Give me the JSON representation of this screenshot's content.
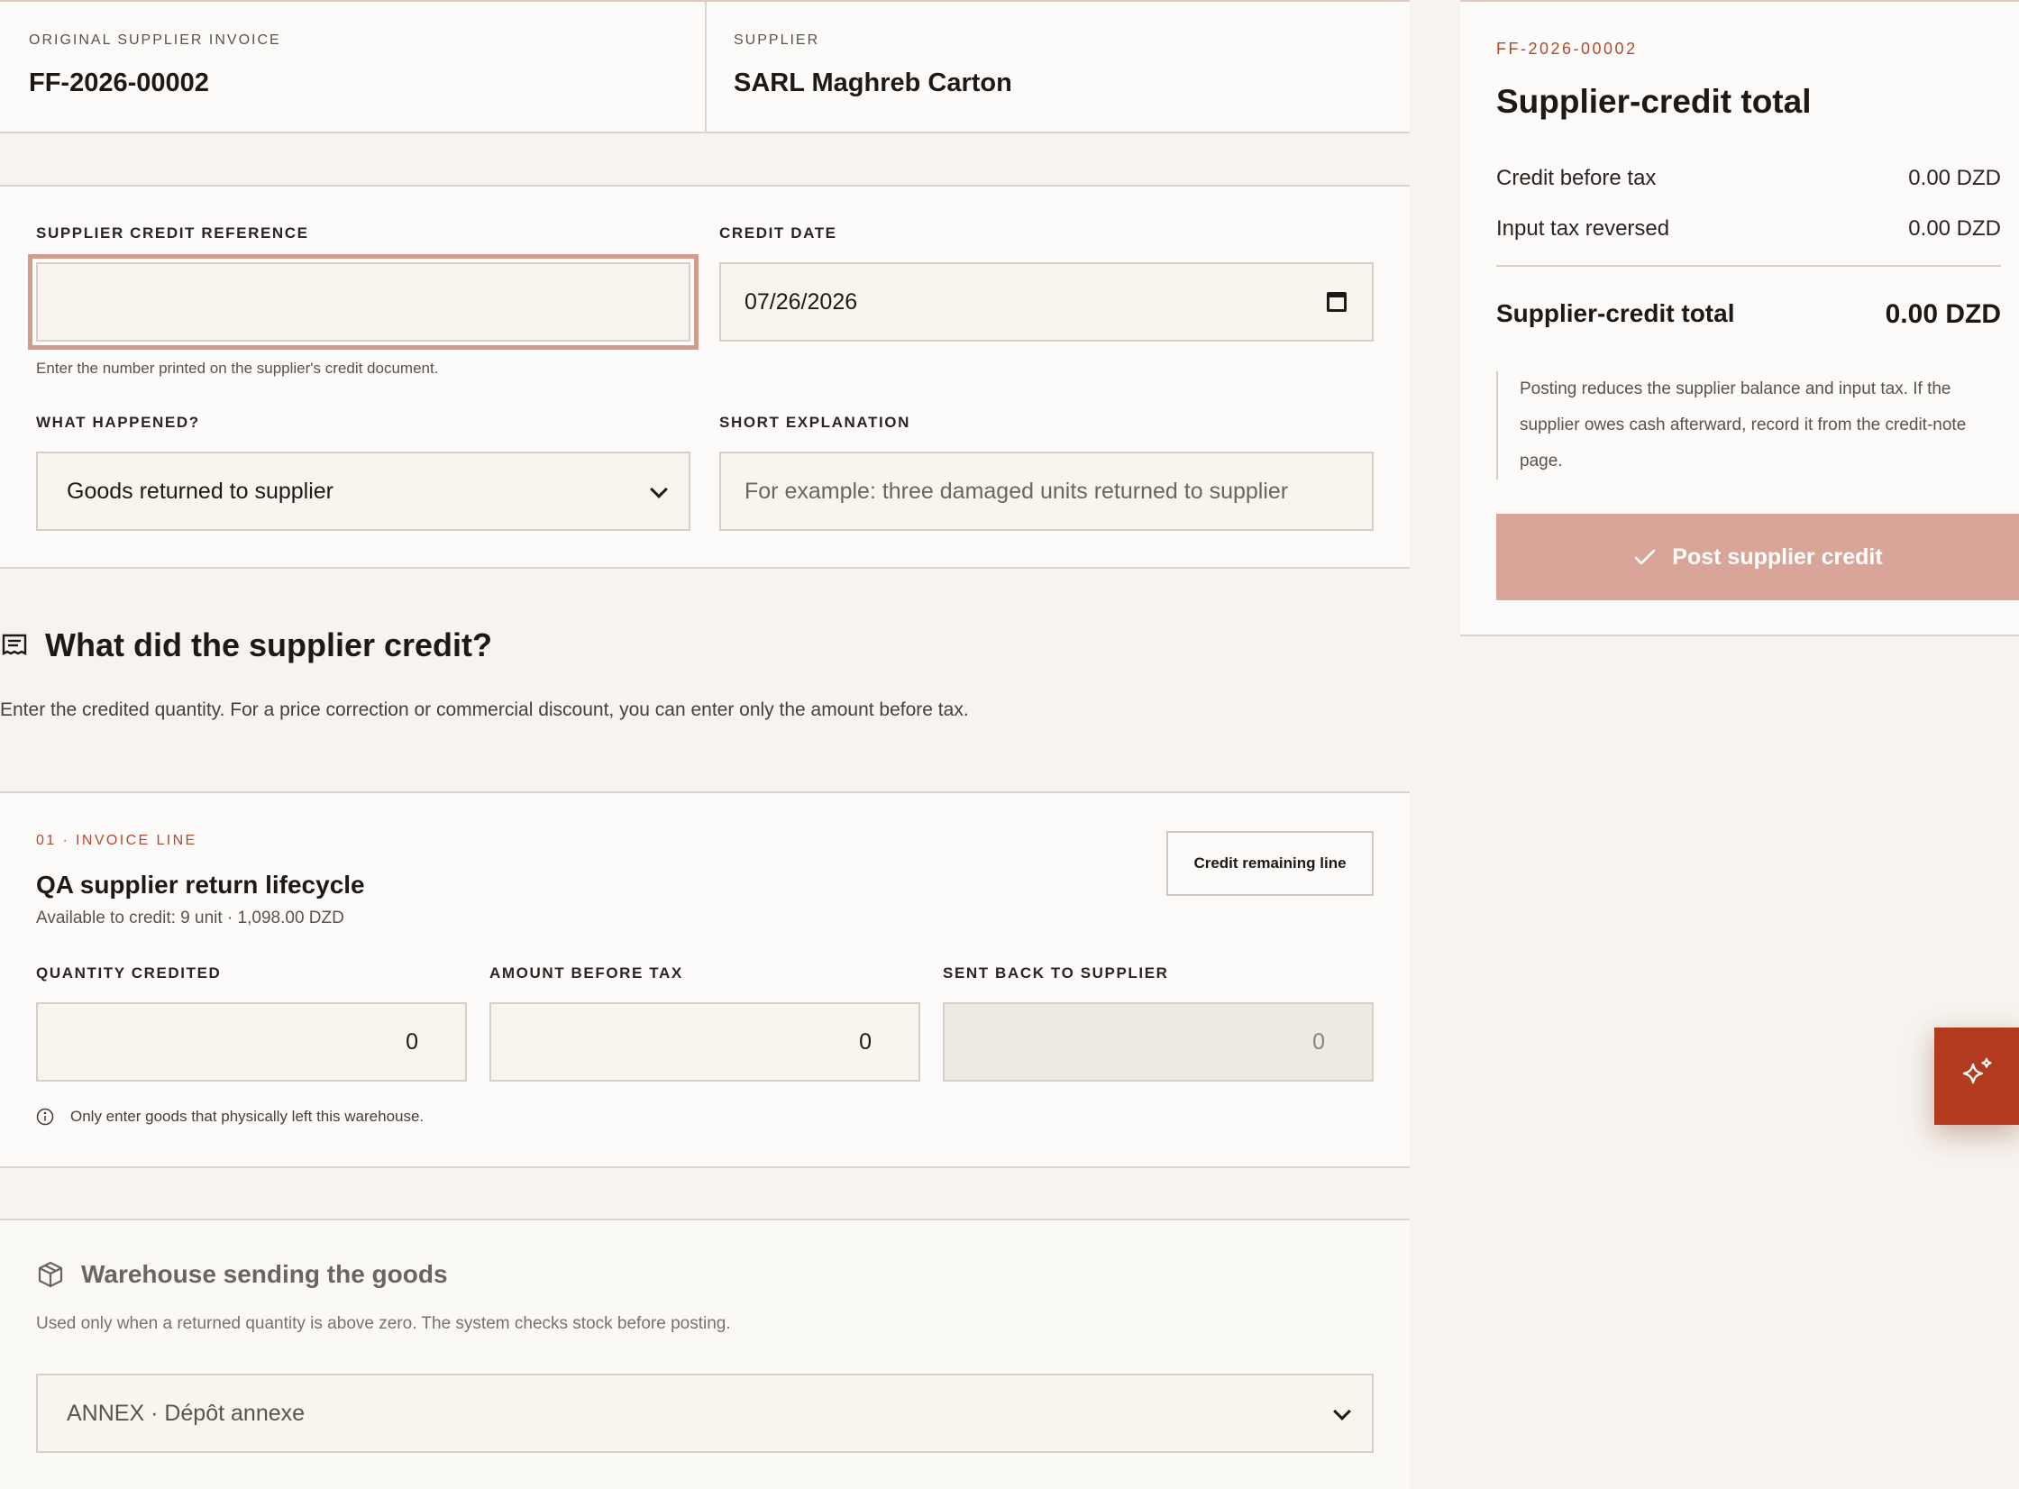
{
  "header": {
    "original_invoice_label": "ORIGINAL SUPPLIER INVOICE",
    "original_invoice_value": "FF-2026-00002",
    "supplier_label": "SUPPLIER",
    "supplier_value": "SARL Maghreb Carton"
  },
  "form": {
    "reference_label": "SUPPLIER CREDIT REFERENCE",
    "reference_value": "",
    "reference_hint": "Enter the number printed on the supplier's credit document.",
    "date_label": "CREDIT DATE",
    "date_value": "07/26/2026",
    "reason_label": "WHAT HAPPENED?",
    "reason_value": "Goods returned to supplier",
    "explanation_label": "SHORT EXPLANATION",
    "explanation_placeholder": "For example: three damaged units returned to supplier"
  },
  "section": {
    "title": "What did the supplier credit?",
    "description": "Enter the credited quantity. For a price correction or commercial discount, you can enter only the amount before tax."
  },
  "line": {
    "tag": "01 · INVOICE LINE",
    "title": "QA supplier return lifecycle",
    "subtitle": "Available to credit: 9 unit · 1,098.00 DZD",
    "credit_remaining_button": "Credit remaining line",
    "quantity_label": "QUANTITY CREDITED",
    "quantity_value": "0",
    "amount_label": "AMOUNT BEFORE TAX",
    "amount_value": "0",
    "sent_back_label": "SENT BACK TO SUPPLIER",
    "sent_back_value": "0",
    "info_text": "Only enter goods that physically left this warehouse."
  },
  "warehouse": {
    "title": "Warehouse sending the goods",
    "description": "Used only when a returned quantity is above zero. The system checks stock before posting.",
    "selected": "ANNEX · Dépôt annexe"
  },
  "summary": {
    "tag": "FF-2026-00002",
    "title": "Supplier-credit total",
    "credit_before_tax_label": "Credit before tax",
    "credit_before_tax_value": "0.00 DZD",
    "input_tax_label": "Input tax reversed",
    "input_tax_value": "0.00 DZD",
    "total_label": "Supplier-credit total",
    "total_value": "0.00 DZD",
    "note": "Posting reduces the supplier balance and input tax. If the supplier owes cash afterward, record it from the credit-note page.",
    "post_button": "Post supplier credit"
  },
  "icons": {
    "section_icon": "receipt-icon",
    "info_icon": "info-icon",
    "warehouse_icon": "package-icon",
    "post_icon": "check-icon",
    "fab_icon": "sparkle-icon"
  },
  "colors": {
    "accent": "#b23a1e",
    "post_button": "#d9a598",
    "focus_ring": "#d19c8c",
    "tag_text": "#b04a2f"
  }
}
